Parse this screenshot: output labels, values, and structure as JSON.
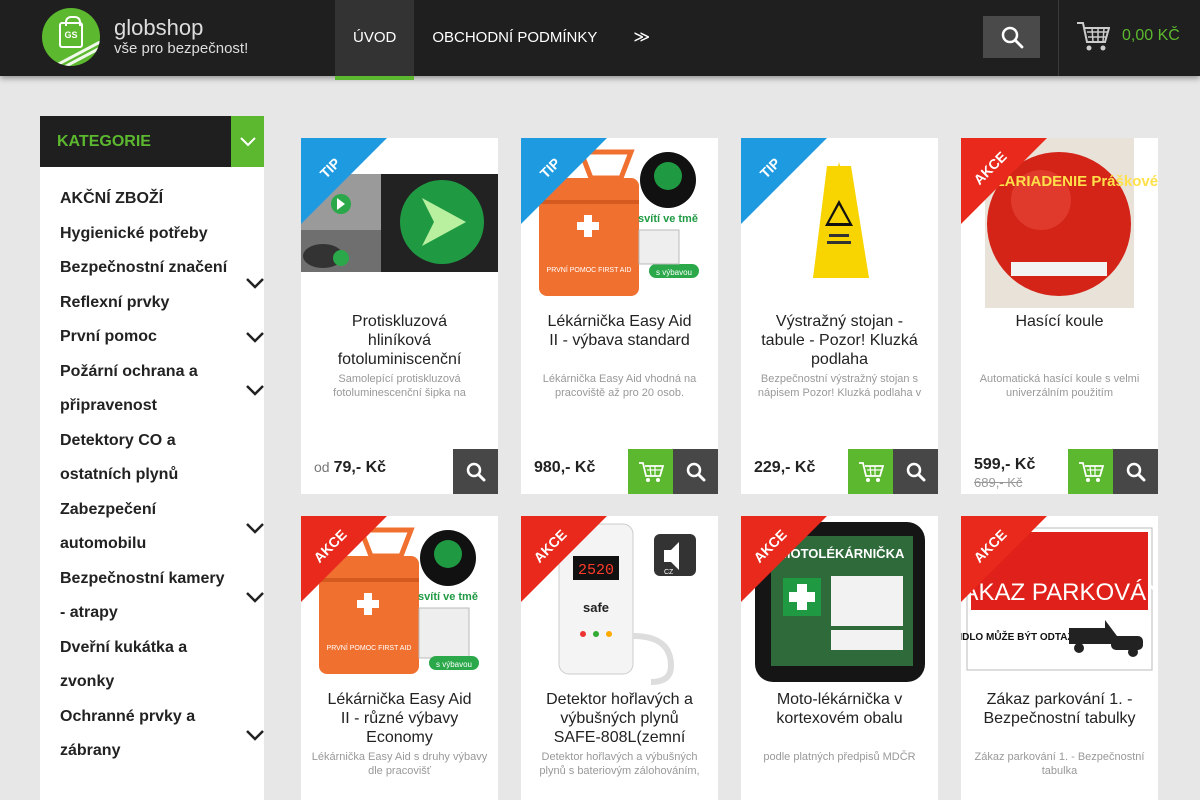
{
  "header": {
    "logo_name": "globshop",
    "logo_sub": "vše pro bezpečnost!",
    "logo_badge": "GS",
    "nav": [
      {
        "label": "ÚVOD",
        "active": true
      },
      {
        "label": "OBCHODNÍ PODMÍNKY",
        "active": false
      },
      {
        "label": "≫",
        "active": false
      }
    ],
    "search_icon": "search-icon",
    "cart_total": "0,00 KČ",
    "cart_icon": "cart-icon"
  },
  "sidebar": {
    "title": "KATEGORIE",
    "items": [
      {
        "label": "AKČNÍ ZBOŽÍ",
        "has_sub": false
      },
      {
        "label": "Hygienické potřeby",
        "has_sub": false
      },
      {
        "label": "Bezpečnostní značení",
        "has_sub": true
      },
      {
        "label": "Reflexní prvky",
        "has_sub": false
      },
      {
        "label": "První pomoc",
        "has_sub": true
      },
      {
        "label": "Požární ochrana a připravenost",
        "has_sub": true
      },
      {
        "label": "Detektory CO a ostatních plynů",
        "has_sub": false
      },
      {
        "label": "Zabezpečení automobilu",
        "has_sub": true
      },
      {
        "label": "Bezpečnostní kamery - atrapy",
        "has_sub": true
      },
      {
        "label": "Dveřní kukátka a zvonky",
        "has_sub": false
      },
      {
        "label": "Ochranné prvky a zábrany",
        "has_sub": true
      }
    ]
  },
  "products": [
    {
      "badge": "TIP",
      "title": "Protiskluzová hliníková fotoluminiscenční",
      "desc": "Samolepící protiskluzová fotoluminescenční šipka na",
      "price_prefix": "od",
      "price": "79,- Kč",
      "old_price": "",
      "has_cart": false,
      "image": "arrow-sticker"
    },
    {
      "badge": "TIP",
      "title": "Lékárnička Easy Aid II - výbava standard",
      "desc": "Lékárnička Easy Aid vhodná na pracoviště až pro 20 osob.",
      "price_prefix": "",
      "price": "980,- Kč",
      "old_price": "",
      "has_cart": true,
      "image": "first-aid-kit"
    },
    {
      "badge": "TIP",
      "title": "Výstražný stojan - tabule - Pozor! Kluzká podlaha",
      "desc": "Bezpečnostní výstražný stojan s nápisem Pozor! Kluzká podlaha v",
      "price_prefix": "",
      "price": "229,- Kč",
      "old_price": "",
      "has_cart": true,
      "image": "wet-floor-sign"
    },
    {
      "badge": "AKCE",
      "title": "Hasící koule",
      "desc": "Automatická hasící koule s velmi univerzálním použitím",
      "price_prefix": "",
      "price": "599,- Kč",
      "old_price": "689,- Kč",
      "has_cart": true,
      "image": "fire-ball"
    },
    {
      "badge": "AKCE",
      "title": "Lékárnička Easy Aid II - různé výbavy Economy",
      "desc": "Lékárnička Easy Aid s druhy výbavy dle pracovišť",
      "price_prefix": "",
      "price": "",
      "old_price": "",
      "has_cart": false,
      "image": "first-aid-kit"
    },
    {
      "badge": "AKCE",
      "title": "Detektor hořlavých a výbušných plynů SAFE-808L(zemní",
      "desc": "Detektor hořlavých a výbušných plynů s bateriovým zálohováním,",
      "price_prefix": "",
      "price": "",
      "old_price": "",
      "has_cart": false,
      "image": "gas-detector"
    },
    {
      "badge": "AKCE",
      "title": "Moto-lékárnička v kortexovém obalu",
      "desc": "podle platných předpisů MDČR",
      "price_prefix": "",
      "price": "",
      "old_price": "",
      "has_cart": false,
      "image": "moto-kit"
    },
    {
      "badge": "AKCE",
      "title": "Zákaz parkování 1. - Bezpečnostní tabulky",
      "desc": "Zákaz parkování 1. - Bezpečnostní tabulka",
      "price_prefix": "",
      "price": "",
      "old_price": "",
      "has_cart": false,
      "image": "no-parking-sign"
    }
  ],
  "image_texts": {
    "glow": "svítí ve tmě",
    "kit_label": "PRVNÍ POMOC FIRST AID",
    "kit_with": "s výbavou",
    "fireball": "HASIACE ZARIADENIE Práškové ABC",
    "detector_display": "2520",
    "detector_brand": "safe",
    "detector_lang": "CZ",
    "moto_title": "MOTOLÉKÁRNIČKA",
    "noparking_title": "ZÁKAZ PARKOVÁNÍ",
    "noparking_sub": "VOZIDLO MŮŽE BÝT ODTAŽENO"
  },
  "colors": {
    "accent": "#5cb82e",
    "tip": "#1e9be0",
    "akce": "#e8291c",
    "dark": "#1f1f1f"
  }
}
